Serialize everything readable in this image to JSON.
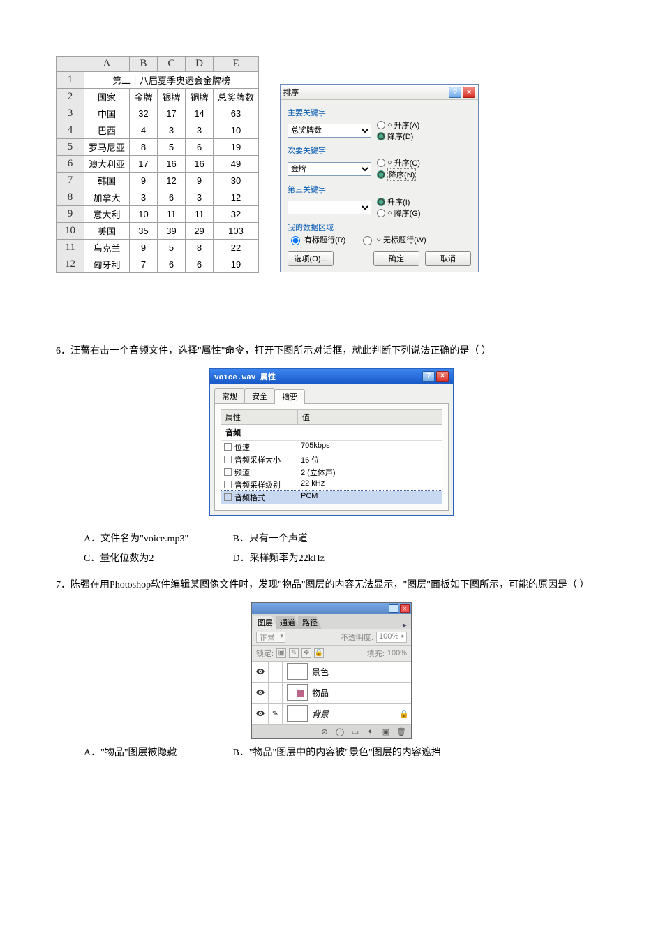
{
  "sheet": {
    "cols": [
      "A",
      "B",
      "C",
      "D",
      "E"
    ],
    "title": "第二十八届夏季奥运会金牌榜",
    "headers": [
      "国家",
      "金牌",
      "银牌",
      "铜牌",
      "总奖牌数"
    ],
    "rows": [
      [
        "中国",
        "32",
        "17",
        "14",
        "63"
      ],
      [
        "巴西",
        "4",
        "3",
        "3",
        "10"
      ],
      [
        "罗马尼亚",
        "8",
        "5",
        "6",
        "19"
      ],
      [
        "澳大利亚",
        "17",
        "16",
        "16",
        "49"
      ],
      [
        "韩国",
        "9",
        "12",
        "9",
        "30"
      ],
      [
        "加拿大",
        "3",
        "6",
        "3",
        "12"
      ],
      [
        "意大利",
        "10",
        "11",
        "11",
        "32"
      ],
      [
        "美国",
        "35",
        "39",
        "29",
        "103"
      ],
      [
        "乌克兰",
        "9",
        "5",
        "8",
        "22"
      ],
      [
        "匈牙利",
        "7",
        "6",
        "6",
        "19"
      ]
    ]
  },
  "sort": {
    "title": "排序",
    "g1": "主要关键字",
    "g2": "次要关键字",
    "g3": "第三关键字",
    "k1_value": "总奖牌数",
    "k2_value": "金牌",
    "k3_value": "",
    "asc_a": "升序(A)",
    "desc_d": "降序(D)",
    "asc_c": "升序(C)",
    "desc_n": "降序(N)",
    "asc_i": "升序(I)",
    "desc_g": "降序(G)",
    "area": "我的数据区域",
    "has_header": "有标题行(R)",
    "no_header": "无标题行(W)",
    "options": "选项(O)...",
    "ok": "确定",
    "cancel": "取消"
  },
  "q6": {
    "text1": "6．汪蔷右击一个音频文件，选择\"属性\"命令，打开下图所示对话框，就此判断下列说法正确的是（     ）",
    "a": "A．文件名为\"voice.mp3\"",
    "b": "B．只有一个声道",
    "c": "C．量化位数为2",
    "d": "D．采样频率为22kHz",
    "dlg": {
      "title": "voice.wav 属性",
      "tab1": "常规",
      "tab2": "安全",
      "tab3": "摘要",
      "h1": "属性",
      "h2": "值",
      "cat": "音频",
      "rows": [
        [
          "位速",
          "705kbps"
        ],
        [
          "音频采样大小",
          "16 位"
        ],
        [
          "频道",
          "2 (立体声)"
        ],
        [
          "音频采样级别",
          "22 kHz"
        ],
        [
          "音频格式",
          "PCM"
        ]
      ]
    }
  },
  "q7": {
    "text": "7．陈强在用Photoshop软件编辑某图像文件时，发现\"物品\"图层的内容无法显示，\"图层\"面板如下图所示，可能的原因是（      ）",
    "a": "A．\"物品\"图层被隐藏",
    "b": "B．\"物品\"图层中的内容被\"景色\"图层的内容遮挡",
    "panel": {
      "tabs": [
        "图层",
        "通道",
        "路径"
      ],
      "blend": "正常",
      "opacity_l": "不透明度:",
      "opacity_v": "100%",
      "lock_l": "锁定:",
      "fill_l": "填充:",
      "fill_v": "100%",
      "layers": [
        "景色",
        "物品",
        "背景"
      ]
    }
  }
}
